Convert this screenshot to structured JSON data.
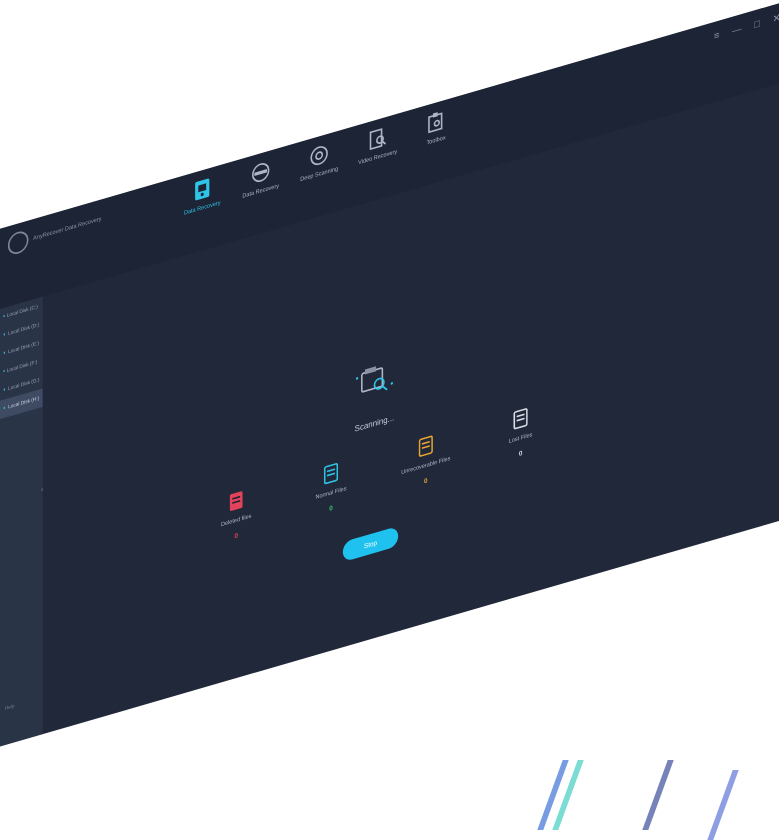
{
  "app": {
    "title": "AnyRecover Data Recovery"
  },
  "nav": [
    {
      "label": "Data Recovery",
      "icon": "data-recovery-icon",
      "active": true
    },
    {
      "label": "Data Recovery",
      "icon": "disk-icon",
      "active": false
    },
    {
      "label": "Deep Scanning",
      "icon": "deep-scan-icon",
      "active": false
    },
    {
      "label": "Video Recovery",
      "icon": "video-repair-icon",
      "active": false
    },
    {
      "label": "Toolbox",
      "icon": "toolbox-icon",
      "active": false
    }
  ],
  "window_controls": {
    "menu": "≡",
    "minimize": "—",
    "maximize": "□",
    "close": "✕"
  },
  "sidebar": {
    "items": [
      {
        "label": "Local Disk (C:)",
        "selected": false
      },
      {
        "label": "Local Disk (D:)",
        "selected": false
      },
      {
        "label": "Local Disk (E:)",
        "selected": false
      },
      {
        "label": "Local Disk (F:)",
        "selected": false
      },
      {
        "label": "Local Disk (G:)",
        "selected": false
      },
      {
        "label": "Local Disk (H:)",
        "selected": true
      }
    ],
    "footer": "Help"
  },
  "scan": {
    "status": "Scanning...",
    "stop_label": "Stop",
    "stats": [
      {
        "label": "Deleted files",
        "value": "0",
        "color": "#e3435a",
        "icon": "deleted-file-icon"
      },
      {
        "label": "Normal Files",
        "value": "0",
        "color": "#2ec5e8",
        "icon": "normal-file-icon"
      },
      {
        "label": "Unrecoverable Files",
        "value": "0",
        "color": "#e7a431",
        "icon": "unrecoverable-file-icon"
      },
      {
        "label": "Lost Files",
        "value": "0",
        "color": "#d9dee6",
        "icon": "lost-file-icon"
      }
    ]
  },
  "colors": {
    "background": "#21283a",
    "accent": "#1fc2ee",
    "sidebar": "#2a3447"
  }
}
